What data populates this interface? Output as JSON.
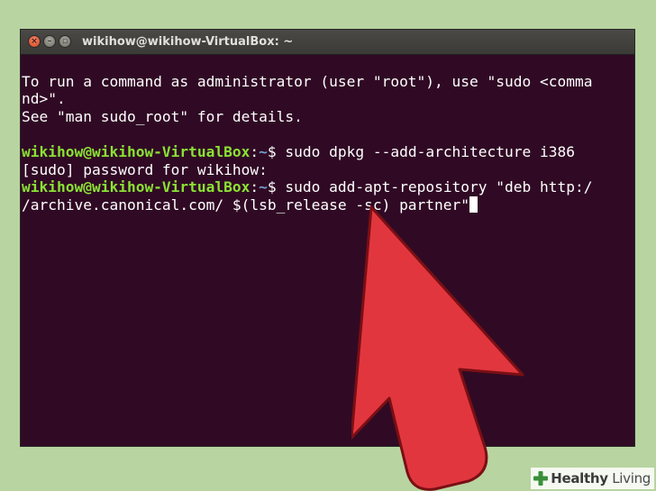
{
  "window": {
    "title": "wikihow@wikihow-VirtualBox: ~",
    "buttons": {
      "close_icon": "close-icon",
      "minimize_icon": "minimize-icon",
      "maximize_icon": "maximize-icon",
      "close_glyph": "×",
      "minimize_glyph": "–",
      "maximize_glyph": "▫"
    }
  },
  "terminal": {
    "lines": [
      "To run a command as administrator (user \"root\"), use \"sudo <comma",
      "nd>\".",
      "See \"man sudo_root\" for details.",
      ""
    ],
    "prompt": {
      "user_host": "wikihow@wikihow-VirtualBox",
      "sep": ":",
      "path": "~",
      "symbol": "$ "
    },
    "cmd1": "sudo dpkg --add-architecture i386",
    "sudo_prompt": "[sudo] password for wikihow:",
    "cmd2_line1": "sudo add-apt-repository \"deb http:/",
    "cmd2_line2": "/archive.canonical.com/ $(lsb_release -sc) partner\""
  },
  "colors": {
    "terminal_bg": "#300a24",
    "prompt_user": "#8ae234",
    "prompt_path": "#729fcf",
    "arrow": "#e2363f",
    "page_bg": "#b8d4a0"
  },
  "watermark": {
    "brand_bold": "Healthy",
    "brand_rest": " Living",
    "icon": "plus-leaf-icon"
  }
}
